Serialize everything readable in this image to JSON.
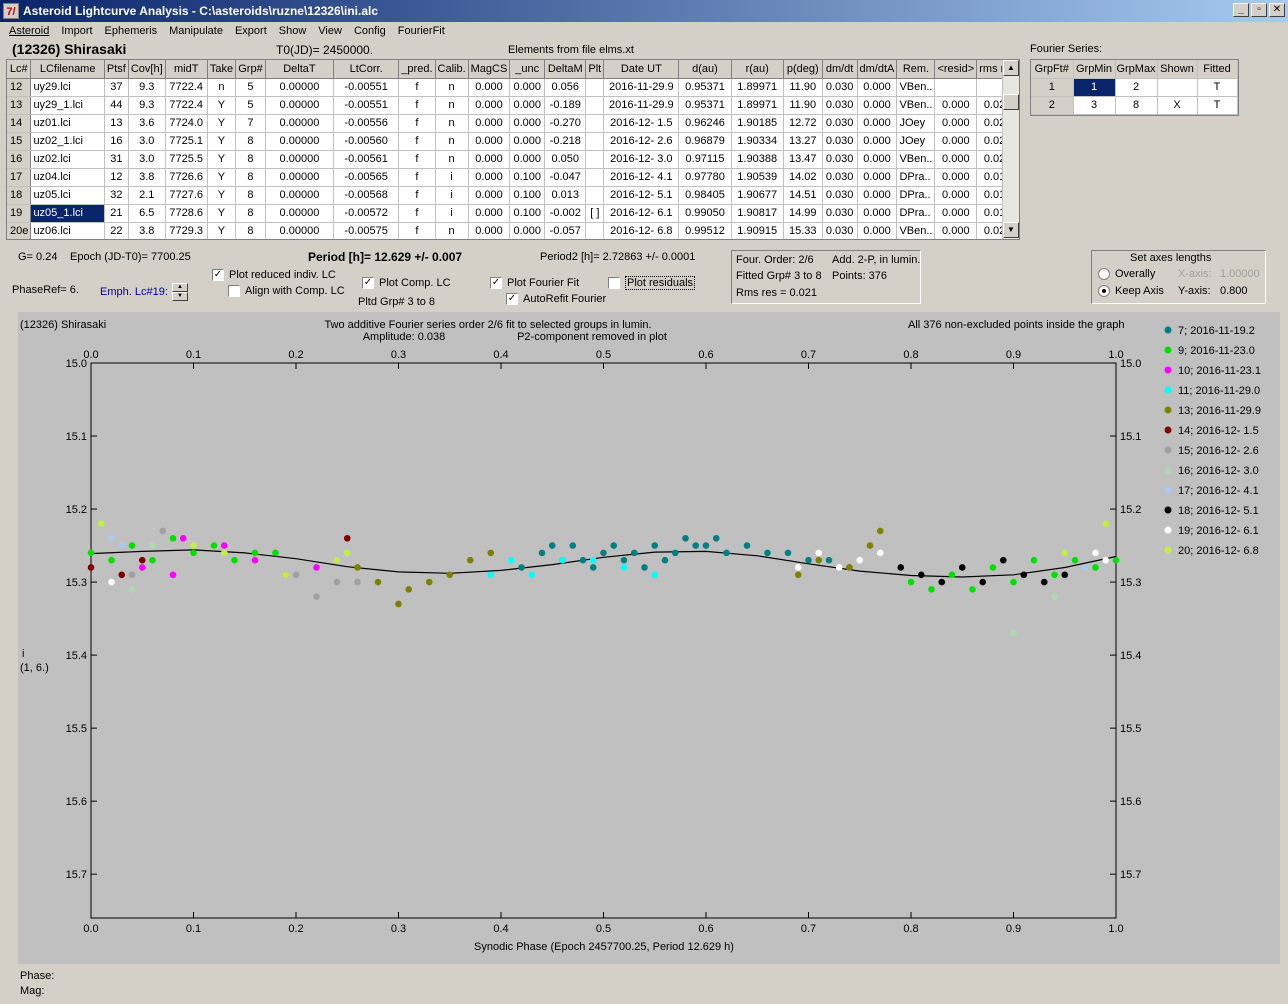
{
  "window": {
    "title": "Asteroid Lightcurve Analysis - C:\\asteroids\\ruzne\\12326\\ini.alc",
    "app_icon": "7/",
    "min_label": "_",
    "restore_label": "▫",
    "close_label": "✕"
  },
  "menu": [
    "Asteroid",
    "Import",
    "Ephemeris",
    "Manipulate",
    "Export",
    "Show",
    "View",
    "Config",
    "FourierFit"
  ],
  "header": {
    "asteroid": "(12326) Shirasaki",
    "t0": "T0(JD)= 2450000.",
    "elements": "Elements from file elms.xt",
    "fourier_series_label": "Fourier Series:"
  },
  "lc_table": {
    "columns": [
      "Lc#",
      "LCfilename",
      "Ptsf",
      "Cov[h]",
      "midT",
      "Take",
      "Grp#",
      "DeltaT",
      "LtCorr.",
      "_pred.",
      "Calib.",
      "MagCS",
      "_unc",
      "DeltaM",
      "Plt",
      "Date UT",
      "d(au)",
      "r(au)",
      "p(deg)",
      "dm/dt",
      "dm/dtA",
      "Rem.",
      "<resid>",
      "rms res"
    ],
    "rows": [
      [
        "12",
        "uy29.lci",
        "37",
        "9.3",
        "7722.4",
        "n",
        "5",
        "0.00000",
        "-0.00551",
        "f",
        "n",
        "0.000",
        "0.000",
        "0.056",
        "",
        "2016-11-29.9",
        "0.95371",
        "1.89971",
        "11.90",
        "0.030",
        "0.000",
        "VBen..",
        "",
        ""
      ],
      [
        "13",
        "uy29_1.lci",
        "44",
        "9.3",
        "7722.4",
        "Y",
        "5",
        "0.00000",
        "-0.00551",
        "f",
        "n",
        "0.000",
        "0.000",
        "-0.189",
        "",
        "2016-11-29.9",
        "0.95371",
        "1.89971",
        "11.90",
        "0.030",
        "0.000",
        "VBen..",
        "0.000",
        "0.025"
      ],
      [
        "14",
        "uz01.lci",
        "13",
        "3.6",
        "7724.0",
        "Y",
        "7",
        "0.00000",
        "-0.00556",
        "f",
        "n",
        "0.000",
        "0.000",
        "-0.270",
        "",
        "2016-12- 1.5",
        "0.96246",
        "1.90185",
        "12.72",
        "0.030",
        "0.000",
        "JOey",
        "0.000",
        "0.022"
      ],
      [
        "15",
        "uz02_1.lci",
        "16",
        "3.0",
        "7725.1",
        "Y",
        "8",
        "0.00000",
        "-0.00560",
        "f",
        "n",
        "0.000",
        "0.000",
        "-0.218",
        "",
        "2016-12- 2.6",
        "0.96879",
        "1.90334",
        "13.27",
        "0.030",
        "0.000",
        "JOey",
        "0.000",
        "0.028"
      ],
      [
        "16",
        "uz02.lci",
        "31",
        "3.0",
        "7725.5",
        "Y",
        "8",
        "0.00000",
        "-0.00561",
        "f",
        "n",
        "0.000",
        "0.000",
        "0.050",
        "",
        "2016-12- 3.0",
        "0.97115",
        "1.90388",
        "13.47",
        "0.030",
        "0.000",
        "VBen..",
        "0.000",
        "0.029"
      ],
      [
        "17",
        "uz04.lci",
        "12",
        "3.8",
        "7726.6",
        "Y",
        "8",
        "0.00000",
        "-0.00565",
        "f",
        "i",
        "0.000",
        "0.100",
        "-0.047",
        "",
        "2016-12- 4.1",
        "0.97780",
        "1.90539",
        "14.02",
        "0.030",
        "0.000",
        "DPra..",
        "0.000",
        "0.018"
      ],
      [
        "18",
        "uz05.lci",
        "32",
        "2.1",
        "7727.6",
        "Y",
        "8",
        "0.00000",
        "-0.00568",
        "f",
        "i",
        "0.000",
        "0.100",
        "0.013",
        "",
        "2016-12- 5.1",
        "0.98405",
        "1.90677",
        "14.51",
        "0.030",
        "0.000",
        "DPra..",
        "0.000",
        "0.013"
      ],
      [
        "19",
        "uz05_1.lci",
        "21",
        "6.5",
        "7728.6",
        "Y",
        "8",
        "0.00000",
        "-0.00572",
        "f",
        "i",
        "0.000",
        "0.100",
        "-0.002",
        "[ ]",
        "2016-12- 6.1",
        "0.99050",
        "1.90817",
        "14.99",
        "0.030",
        "0.000",
        "DPra..",
        "0.000",
        "0.013"
      ],
      [
        "20e",
        "uz06.lci",
        "22",
        "3.8",
        "7729.3",
        "Y",
        "8",
        "0.00000",
        "-0.00575",
        "f",
        "n",
        "0.000",
        "0.000",
        "-0.057",
        "",
        "2016-12- 6.8",
        "0.99512",
        "1.90915",
        "15.33",
        "0.030",
        "0.000",
        "VBen..",
        "0.000",
        "0.026"
      ]
    ],
    "selected_row": "19"
  },
  "fourier_table": {
    "columns": [
      "GrpFt#",
      "GrpMin",
      "GrpMax",
      "Shown",
      "Fitted"
    ],
    "rows": [
      [
        "1",
        "1",
        "2",
        "",
        "T"
      ],
      [
        "2",
        "3",
        "8",
        "X",
        "T"
      ]
    ]
  },
  "controls": {
    "g": "G= 0.24",
    "epoch": "Epoch (JD-T0)= 7700.25",
    "period": "Period [h]= 12.629 +/- 0.007",
    "period2": "Period2 [h]= 2.72863 +/- 0.0001",
    "phase_ref": "PhaseRef= 6.",
    "emph": "Emph. Lc#19:",
    "plot_reduced": "Plot reduced indiv. LC",
    "align_comp": "Align with Comp. LC",
    "plot_comp": "Plot Comp. LC",
    "pltd_grp": "Pltd Grp#  3  to  8",
    "plot_fourier": "Plot Fourier Fit",
    "autorefit": "AutoRefit Fourier",
    "plot_residuals": "Plot residuals",
    "four_order": "Four. Order:  2/6",
    "add_2p": "Add. 2-P, in lumin.",
    "fitted_grp": "Fitted Grp# 3 to 8",
    "points": "Points: 376",
    "rms": "Rms res     = 0.021",
    "axes_title": "Set axes lengths",
    "overally": "Overally",
    "keep_axis": "Keep Axis",
    "xaxis_label": "X-axis:",
    "xaxis_value": "1.00000",
    "yaxis_label": "Y-axis:",
    "yaxis_value": "0.800"
  },
  "plot": {
    "object": "(12326) Shirasaki",
    "title1": "Two additive Fourier series order 2/6 fit to selected groups in lumin.",
    "title2a": "Amplitude: 0.038",
    "title2b": "P2-component removed in plot",
    "right_note": "All 376 non-excluded points inside the graph",
    "ylabel1": "i",
    "ylabel2": "(1, 6.)",
    "xlabel": "Synodic Phase (Epoch 2457700.25, Period 12.629 h)"
  },
  "status": {
    "phase": "Phase:",
    "mag": "Mag:"
  },
  "chart_data": {
    "type": "scatter",
    "title": "Two additive Fourier series order 2/6 fit to selected groups in lumin.",
    "xlabel": "Synodic Phase (Epoch 2457700.25, Period 12.629 h)",
    "ylabel": "",
    "xlim": [
      0.0,
      1.0
    ],
    "ylim": [
      15.76,
      15.0
    ],
    "x_ticks": [
      0.0,
      0.1,
      0.2,
      0.3,
      0.4,
      0.5,
      0.6,
      0.7,
      0.8,
      0.9,
      1.0
    ],
    "y_ticks": [
      15.0,
      15.1,
      15.2,
      15.3,
      15.4,
      15.5,
      15.6,
      15.7
    ],
    "y_inverted": true,
    "grid": false,
    "legend_placement": "right-outside",
    "fit_curve": {
      "x": [
        0.0,
        0.05,
        0.1,
        0.15,
        0.2,
        0.25,
        0.3,
        0.35,
        0.4,
        0.45,
        0.5,
        0.55,
        0.6,
        0.65,
        0.7,
        0.75,
        0.8,
        0.85,
        0.9,
        0.95,
        1.0
      ],
      "y": [
        15.261,
        15.258,
        15.256,
        15.26,
        15.268,
        15.279,
        15.286,
        15.288,
        15.284,
        15.276,
        15.266,
        15.259,
        15.258,
        15.264,
        15.275,
        15.285,
        15.291,
        15.293,
        15.29,
        15.28,
        15.265
      ]
    },
    "series": [
      {
        "name": "7; 2016-11-19.2",
        "color": "#008080",
        "x": [
          0.42,
          0.44,
          0.46,
          0.47,
          0.49,
          0.5,
          0.52,
          0.53,
          0.55,
          0.56,
          0.58,
          0.59,
          0.61,
          0.62,
          0.64,
          0.66,
          0.68,
          0.7,
          0.72,
          0.74,
          0.45,
          0.48,
          0.51,
          0.54,
          0.57,
          0.6
        ],
        "y": [
          15.28,
          15.26,
          15.27,
          15.25,
          15.28,
          15.26,
          15.27,
          15.26,
          15.25,
          15.27,
          15.24,
          15.25,
          15.24,
          15.26,
          15.25,
          15.26,
          15.26,
          15.27,
          15.27,
          15.28,
          15.25,
          15.27,
          15.25,
          15.28,
          15.26,
          15.25
        ]
      },
      {
        "name": "9; 2016-11-23.0",
        "color": "#00e000",
        "x": [
          0.0,
          0.02,
          0.04,
          0.06,
          0.08,
          0.1,
          0.12,
          0.14,
          0.16,
          0.18,
          0.8,
          0.82,
          0.84,
          0.86,
          0.88,
          0.9,
          0.92,
          0.94,
          0.96,
          0.98,
          1.0
        ],
        "y": [
          15.26,
          15.27,
          15.25,
          15.27,
          15.24,
          15.26,
          15.25,
          15.27,
          15.26,
          15.26,
          15.3,
          15.31,
          15.29,
          15.31,
          15.28,
          15.3,
          15.27,
          15.29,
          15.27,
          15.28,
          15.27
        ]
      },
      {
        "name": "10; 2016-11-23.1",
        "color": "#ff00ff",
        "x": [
          0.05,
          0.08,
          0.09,
          0.13,
          0.16,
          0.19,
          0.22
        ],
        "y": [
          15.28,
          15.29,
          15.24,
          15.25,
          15.27,
          15.29,
          15.28
        ]
      },
      {
        "name": "11; 2016-11-29.0",
        "color": "#00ffff",
        "x": [
          0.39,
          0.41,
          0.43,
          0.46,
          0.49,
          0.52,
          0.55
        ],
        "y": [
          15.29,
          15.27,
          15.29,
          15.27,
          15.27,
          15.28,
          15.29
        ]
      },
      {
        "name": "13; 2016-11-29.9",
        "color": "#808000",
        "x": [
          0.26,
          0.28,
          0.3,
          0.31,
          0.33,
          0.35,
          0.37,
          0.39,
          0.69,
          0.71,
          0.74,
          0.76,
          0.77
        ],
        "y": [
          15.28,
          15.3,
          15.33,
          15.31,
          15.3,
          15.29,
          15.27,
          15.26,
          15.29,
          15.27,
          15.28,
          15.25,
          15.23
        ]
      },
      {
        "name": "14; 2016-12- 1.5",
        "color": "#800000",
        "x": [
          0.0,
          0.03,
          0.05,
          0.25
        ],
        "y": [
          15.28,
          15.29,
          15.27,
          15.24
        ]
      },
      {
        "name": "15; 2016-12- 2.6",
        "color": "#a0a0a0",
        "x": [
          0.04,
          0.07,
          0.2,
          0.22,
          0.24,
          0.26
        ],
        "y": [
          15.29,
          15.23,
          15.29,
          15.32,
          15.3,
          15.3
        ]
      },
      {
        "name": "16; 2016-12- 3.0",
        "color": "#b0d8b0",
        "x": [
          0.04,
          0.06,
          0.9,
          0.94
        ],
        "y": [
          15.31,
          15.25,
          15.37,
          15.32
        ]
      },
      {
        "name": "17; 2016-12- 4.1",
        "color": "#a8c8f0",
        "x": [
          0.02,
          0.03,
          0.97
        ],
        "y": [
          15.24,
          15.25,
          15.28
        ]
      },
      {
        "name": "18; 2016-12- 5.1",
        "color": "#000000",
        "x": [
          0.79,
          0.81,
          0.83,
          0.85,
          0.87,
          0.89,
          0.91,
          0.93,
          0.95
        ],
        "y": [
          15.28,
          15.29,
          15.3,
          15.28,
          15.3,
          15.27,
          15.29,
          15.3,
          15.29
        ]
      },
      {
        "name": "19; 2016-12- 6.1",
        "color": "#ffffff",
        "x": [
          0.02,
          0.69,
          0.71,
          0.73,
          0.75,
          0.77,
          0.98,
          0.99
        ],
        "y": [
          15.3,
          15.28,
          15.26,
          15.28,
          15.27,
          15.26,
          15.26,
          15.27
        ]
      },
      {
        "name": "20; 2016-12- 6.8",
        "color": "#c0f040",
        "x": [
          0.01,
          0.1,
          0.13,
          0.19,
          0.24,
          0.25,
          0.95,
          0.99
        ],
        "y": [
          15.22,
          15.25,
          15.26,
          15.29,
          15.27,
          15.26,
          15.26,
          15.22
        ]
      }
    ]
  }
}
